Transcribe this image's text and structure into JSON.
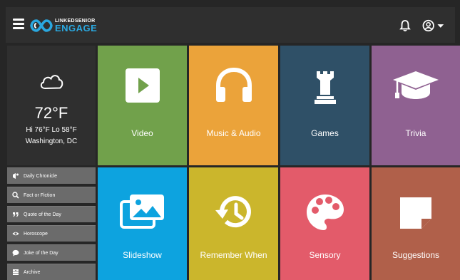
{
  "header": {
    "logo_top": "LINKEDSENIOR",
    "logo_bottom": "ENGAGE"
  },
  "weather": {
    "temperature": "72°F",
    "hilo": "Hi 76°F Lo 58°F",
    "location": "Washington, DC"
  },
  "side_items": [
    {
      "label": "Daily Chronicle",
      "icon": "bell-icon"
    },
    {
      "label": "Fact or Fiction",
      "icon": "search-icon"
    },
    {
      "label": "Quote of the Day",
      "icon": "quote-icon"
    },
    {
      "label": "Horoscope",
      "icon": "eye-icon"
    },
    {
      "label": "Joke of the Day",
      "icon": "speech-bubble-icon"
    },
    {
      "label": "Archive",
      "icon": "archive-icon"
    }
  ],
  "tiles": [
    {
      "label": "Video",
      "icon": "play-icon",
      "color": "#71a14b"
    },
    {
      "label": "Music & Audio",
      "icon": "headphones-icon",
      "color": "#eba33a"
    },
    {
      "label": "Games",
      "icon": "chess-rook-icon",
      "color": "#2f5067"
    },
    {
      "label": "Trivia",
      "icon": "graduation-cap-icon",
      "color": "#8f6191"
    },
    {
      "label": "Slideshow",
      "icon": "images-icon",
      "color": "#0da3df"
    },
    {
      "label": "Remember When",
      "icon": "history-icon",
      "color": "#cbb62c"
    },
    {
      "label": "Sensory",
      "icon": "palette-icon",
      "color": "#e35b6a"
    },
    {
      "label": "Suggestions",
      "icon": "note-icon",
      "color": "#b0604a"
    }
  ]
}
